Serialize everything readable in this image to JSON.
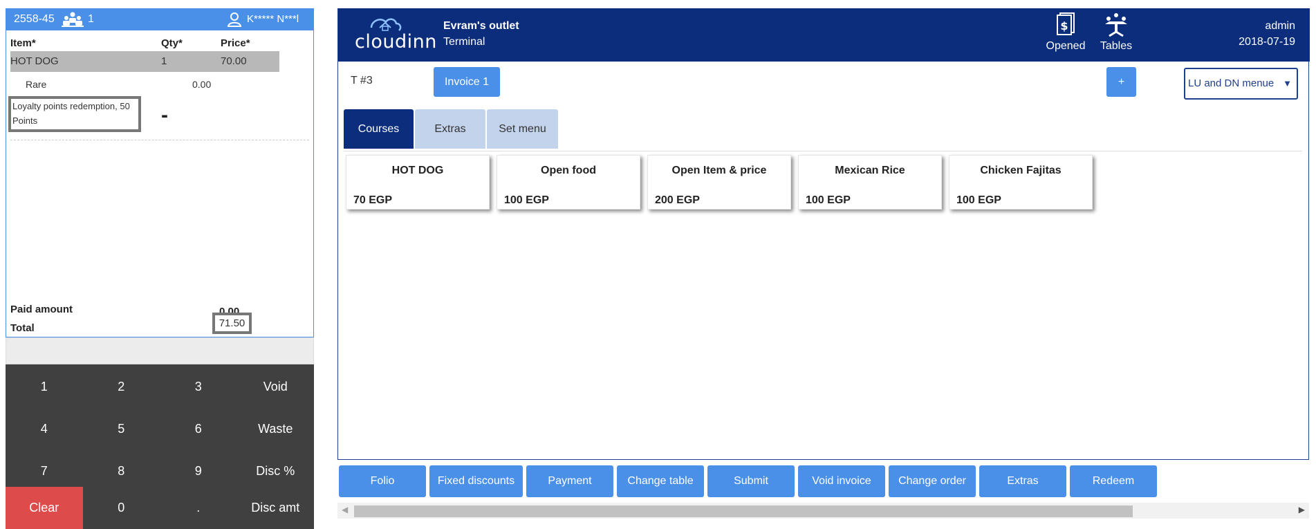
{
  "ticket": {
    "table_id": "2558-45",
    "guests": "1",
    "user": "K***** N***l",
    "headers": {
      "item": "Item*",
      "qty": "Qty*",
      "price": "Price*"
    },
    "selected_item": {
      "name": "HOT DOG",
      "qty": "1",
      "price": "70.00"
    },
    "modifier": {
      "name": "Rare",
      "price": "0.00"
    },
    "loyalty": "Loyalty points redemption, 50 Points",
    "loyalty_mark": "-",
    "paid_label": "Paid amount",
    "paid_value": "0.00",
    "total_label": "Total",
    "total_value": "71.50"
  },
  "numpad": {
    "keys": [
      "1",
      "2",
      "3",
      "Void",
      "4",
      "5",
      "6",
      "Waste",
      "7",
      "8",
      "9",
      "Disc %",
      "Clear",
      "0",
      ".",
      "Disc amt"
    ]
  },
  "header": {
    "logo_text": "cloudinn",
    "outlet": "Evram's outlet",
    "terminal": "Terminal",
    "opened_label": "Opened",
    "tables_label": "Tables",
    "user": "admin",
    "date": "2018-07-19"
  },
  "toolbar": {
    "table_number": "T #3",
    "invoice_label": "Invoice 1",
    "plus_label": "+",
    "menu_selected": "LU and DN menue",
    "menu_caret": "▼"
  },
  "tabs": [
    "Courses",
    "Extras",
    "Set menu"
  ],
  "items": [
    {
      "name": "HOT DOG",
      "price": "70 EGP"
    },
    {
      "name": "Open food",
      "price": "100 EGP"
    },
    {
      "name": "Open Item & price",
      "price": "200 EGP"
    },
    {
      "name": "Mexican Rice",
      "price": "100 EGP"
    },
    {
      "name": "Chicken Fajitas",
      "price": "100 EGP"
    }
  ],
  "actions": [
    "Folio",
    "Fixed discounts",
    "Payment",
    "Change table",
    "Submit",
    "Void invoice",
    "Change order",
    "Extras",
    "Redeem"
  ],
  "colors": {
    "accent": "#4a90e8",
    "navy": "#0b2d7c",
    "numpad": "#404040",
    "clear": "#dd4b4b"
  }
}
